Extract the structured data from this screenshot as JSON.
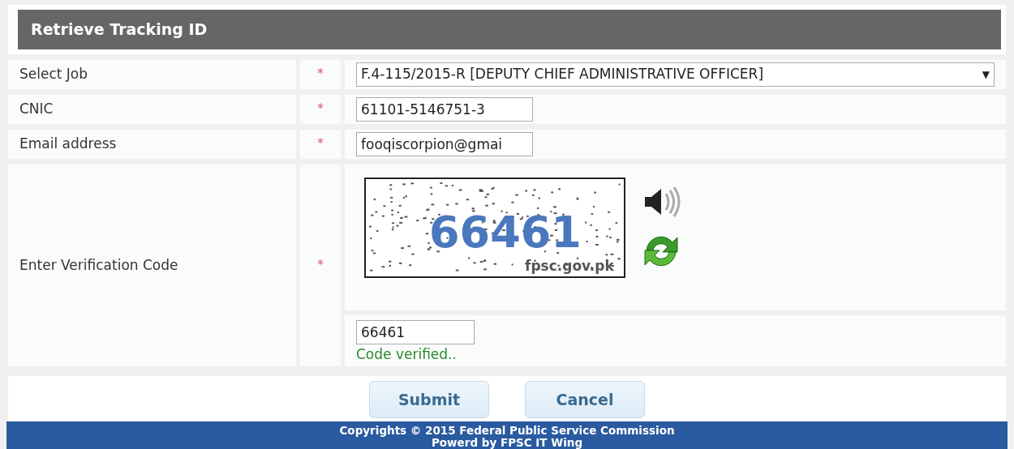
{
  "title": "Retrieve Tracking ID",
  "fields": [
    {
      "kind": "select",
      "label": "Select Job",
      "required": true,
      "value": "F.4-115/2015-R [DEPUTY CHIEF ADMINISTRATIVE OFFICER]",
      "caret": "▼"
    },
    {
      "kind": "text",
      "label": "CNIC",
      "required": true,
      "value": "61101-5146751-3"
    },
    {
      "kind": "text",
      "label": "Email address",
      "required": true,
      "value": "fooqiscorpion@gmai"
    },
    {
      "kind": "captcha",
      "label": "Enter Verification Code",
      "required": true,
      "captcha_code": "66461",
      "captcha_site": "fpsc.gov.pk",
      "value": "66461",
      "message": "Code verified.."
    }
  ],
  "required_mark": "*",
  "buttons": [
    "Submit",
    "Cancel"
  ],
  "footer": [
    "Copyrights © 2015 Federal Public Service Commission",
    "Powerd by FPSC IT Wing"
  ]
}
